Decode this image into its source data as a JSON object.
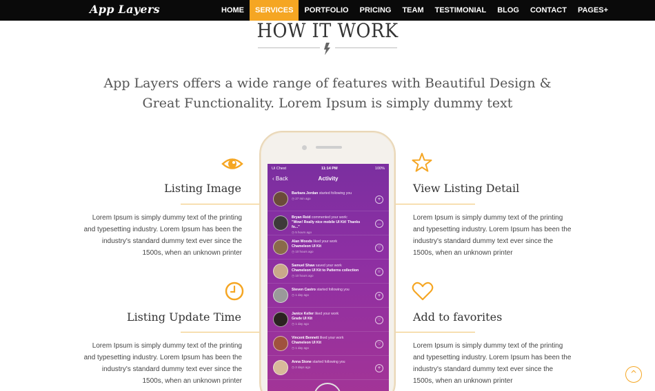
{
  "brand": "App Layers",
  "nav": [
    {
      "label": "HOME",
      "active": false
    },
    {
      "label": "SERVICES",
      "active": true
    },
    {
      "label": "PORTFOLIO",
      "active": false
    },
    {
      "label": "PRICING",
      "active": false
    },
    {
      "label": "TEAM",
      "active": false
    },
    {
      "label": "TESTIMONIAL",
      "active": false
    },
    {
      "label": "BLOG",
      "active": false
    },
    {
      "label": "CONTACT",
      "active": false
    },
    {
      "label": "PAGES",
      "active": false
    }
  ],
  "section": {
    "title": "HOW IT WORK",
    "lead": "App Layers offers a wide range of features with Beautiful Design & Great Functionality. Lorem Ipsum is simply dummy text"
  },
  "features": {
    "listing_image": {
      "title": "Listing Image",
      "text": "Lorem Ipsum is simply dummy text of the printing and typesetting industry. Lorem Ipsum has been the industry's standard dummy text ever since the 1500s, when an unknown printer"
    },
    "view_listing_detail": {
      "title": "View Listing Detail",
      "text": "Lorem Ipsum is simply dummy text of the printing and typesetting industry. Lorem Ipsum has been the industry's standard dummy text ever since the 1500s, when an unknown printer"
    },
    "listing_update_time": {
      "title": "Listing Update Time",
      "text": "Lorem Ipsum is simply dummy text of the printing and typesetting industry. Lorem Ipsum has been the industry's standard dummy text ever since the 1500s, when an unknown printer"
    },
    "add_to_favorites": {
      "title": "Add to favorites",
      "text": "Lorem Ipsum is simply dummy text of the printing and typesetting industry. Lorem Ipsum has been the industry's standard dummy text ever since the 1500s, when an unknown printer"
    }
  },
  "phone": {
    "carrier": "Ui Chest",
    "time": "11:14 PM",
    "battery": "100%",
    "back_label": "Back",
    "screen_title": "Activity",
    "activities": [
      {
        "name": "Barbara Jordan",
        "action": "started following you",
        "detail": "",
        "ago": "27 min ago",
        "button": "+",
        "avatar_color": "#6b4a3a"
      },
      {
        "name": "Bryan Reid",
        "action": "commented your work:",
        "detail": "\"Wow! Really nice mobile UI Kit! Thanks fo...\"",
        "ago": "5 hours ago",
        "button": "…",
        "avatar_color": "#3d3a3a"
      },
      {
        "name": "Alan Woods",
        "action": "liked your work",
        "detail": "Chameleon UI Kit",
        "ago": "10 hours ago",
        "button": "♡",
        "avatar_color": "#8a6a4a"
      },
      {
        "name": "Samuel Shaw",
        "action": "saved your work",
        "detail": "Chameleon UI Kit to Patterns collection",
        "ago": "10 hours ago",
        "button": "☆",
        "avatar_color": "#c9a88a"
      },
      {
        "name": "Steven Castro",
        "action": "started following you",
        "detail": "",
        "ago": "1 day ago",
        "button": "+",
        "avatar_color": "#9a9a9a"
      },
      {
        "name": "Janice Keller",
        "action": "liked your work",
        "detail": "Grade UI Kit",
        "ago": "1 day ago",
        "button": "♡",
        "avatar_color": "#2b2222"
      },
      {
        "name": "Vincent Bennett",
        "action": "liked your work",
        "detail": "Chameleon UI Kit",
        "ago": "1 day ago",
        "button": "♡",
        "avatar_color": "#a0523d"
      },
      {
        "name": "Anna Stone",
        "action": "started following you",
        "detail": "",
        "ago": "2 days ago",
        "button": "+",
        "avatar_color": "#d8b99a"
      }
    ]
  },
  "colors": {
    "accent": "#f5a623",
    "nav_bg": "#0a0a0a",
    "screen_purple": "#8d2fa3"
  },
  "icons": {
    "listing_image": "eye-icon",
    "view_listing_detail": "star-icon",
    "listing_update_time": "clock-icon",
    "add_to_favorites": "heart-icon",
    "divider": "lightning-bolt-icon",
    "scroll_top": "chevron-up-icon"
  }
}
